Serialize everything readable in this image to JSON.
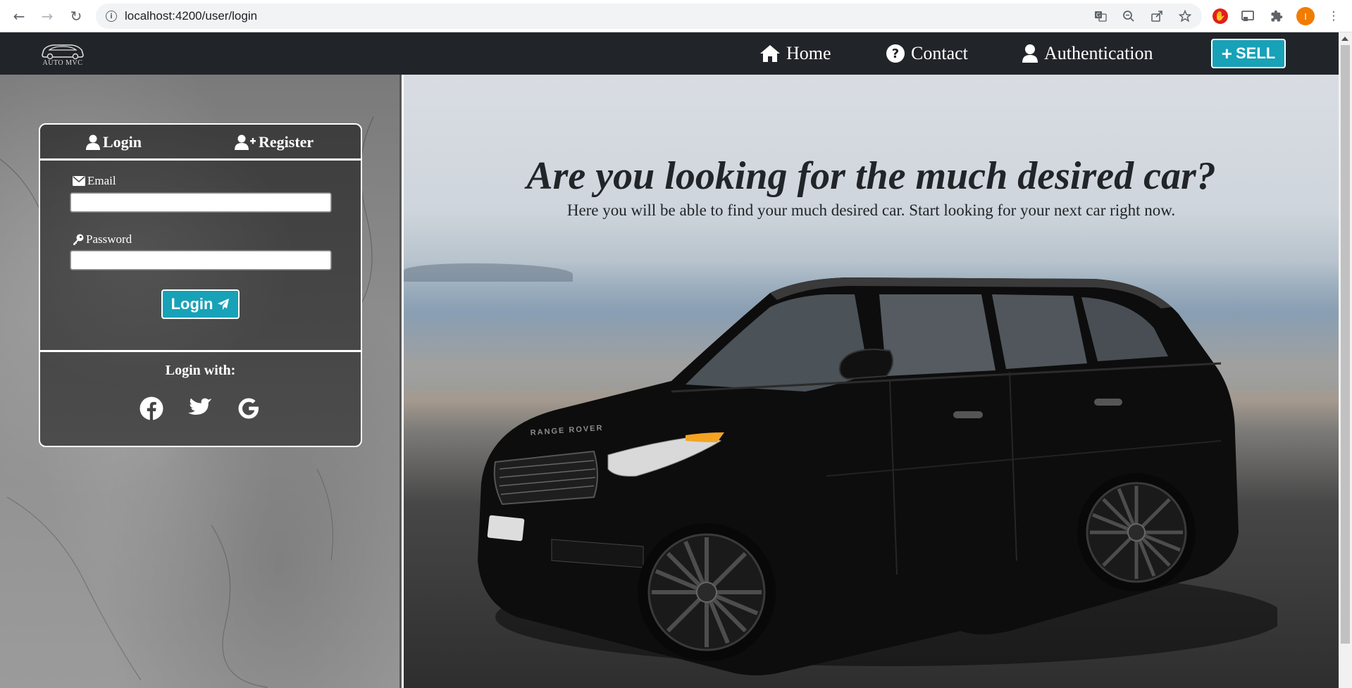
{
  "browser": {
    "url": "localhost:4200/user/login",
    "profile_initial": "I"
  },
  "navbar": {
    "logo_text": "AUTO MVC",
    "links": [
      {
        "label": "Home",
        "icon": "home-icon"
      },
      {
        "label": "Contact",
        "icon": "question-circle-icon"
      },
      {
        "label": "Authentication",
        "icon": "user-icon"
      }
    ],
    "sell_label": "SELL"
  },
  "login_card": {
    "tabs": [
      {
        "label": "Login",
        "icon": "user-icon"
      },
      {
        "label": "Register",
        "icon": "user-plus-icon"
      }
    ],
    "email_label": "Email",
    "email_value": "",
    "password_label": "Password",
    "password_value": "",
    "submit_label": "Login",
    "login_with_label": "Login with:",
    "social": [
      "facebook-icon",
      "twitter-icon",
      "google-icon"
    ]
  },
  "hero": {
    "title": "Are you looking for the much desired car?",
    "subtitle": "Here you will be able to find your much desired car. Start looking for your next car right now.",
    "car_badge": "RANGE ROVER"
  },
  "colors": {
    "navbar_bg": "#212529",
    "accent": "#17a2b8",
    "text_dark": "#212529"
  }
}
